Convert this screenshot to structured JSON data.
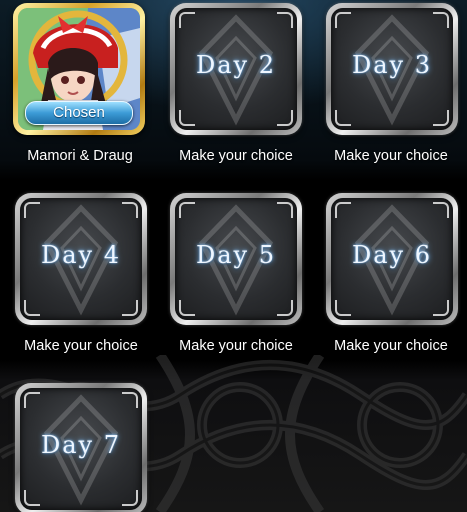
{
  "days": [
    {
      "label": "",
      "caption": "Mamori & Draug",
      "chosen": true,
      "badge": "Chosen"
    },
    {
      "label": "Day 2",
      "caption": "Make your choice"
    },
    {
      "label": "Day 3",
      "caption": "Make your choice"
    },
    {
      "label": "Day 4",
      "caption": "Make your choice"
    },
    {
      "label": "Day 5",
      "caption": "Make your choice"
    },
    {
      "label": "Day 6",
      "caption": "Make your choice"
    },
    {
      "label": "Day 7",
      "caption": ""
    }
  ],
  "colors": {
    "accent_glow": "#6fb8ff",
    "chosen_gold": "#d7a22a",
    "chosen_badge": "#3c9bd6"
  }
}
